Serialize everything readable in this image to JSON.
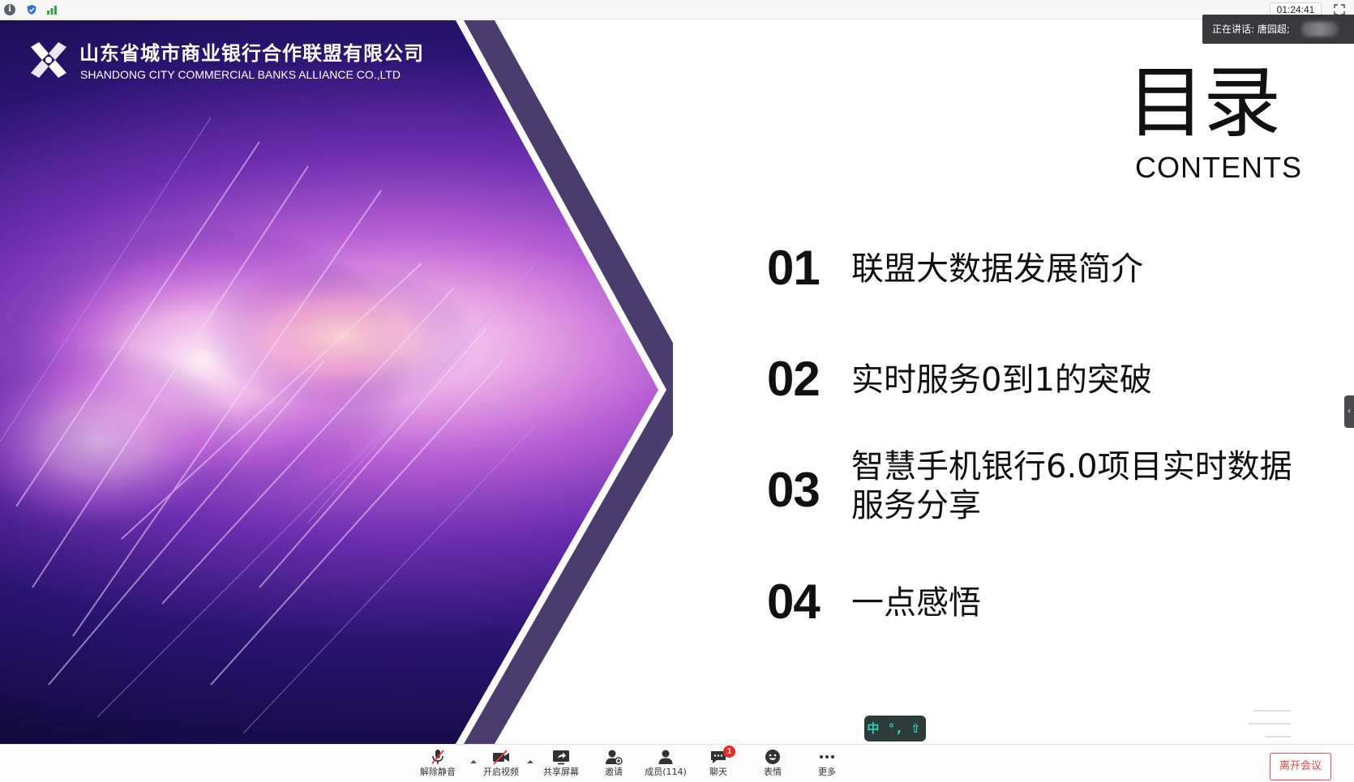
{
  "topbar": {
    "meeting_time": "01:24:41",
    "icons": [
      "info-icon",
      "shield-icon",
      "signal-icon",
      "fullscreen-icon"
    ]
  },
  "speaker": {
    "label": "正在讲话: 唐园超;"
  },
  "slide": {
    "organization_cn": "山东省城市商业银行合作联盟有限公司",
    "organization_en": "SHANDONG CITY COMMERCIAL BANKS ALLIANCE CO.,LTD",
    "title_cn": "目录",
    "title_en": "CONTENTS",
    "items": [
      {
        "number": "01",
        "text": "联盟大数据发展简介"
      },
      {
        "number": "02",
        "text": "实时服务0到1的突破"
      },
      {
        "number": "03",
        "text": "智慧手机银行6.0项目实时数据服务分享"
      },
      {
        "number": "04",
        "text": "一点感悟"
      }
    ],
    "ime_indicator": "中 °, ⇧"
  },
  "toolbar": {
    "unmute": "解除静音",
    "start_video": "开启视频",
    "share_screen": "共享屏幕",
    "invite": "邀请",
    "members": "成员(114)",
    "chat": "聊天",
    "chat_badge": "1",
    "reactions": "表情",
    "more": "更多",
    "leave": "离开会议"
  },
  "colors": {
    "accent_red": "#e04848",
    "chevron_purple": "#4a3d6e",
    "ime_teal": "#2fd0c0"
  }
}
